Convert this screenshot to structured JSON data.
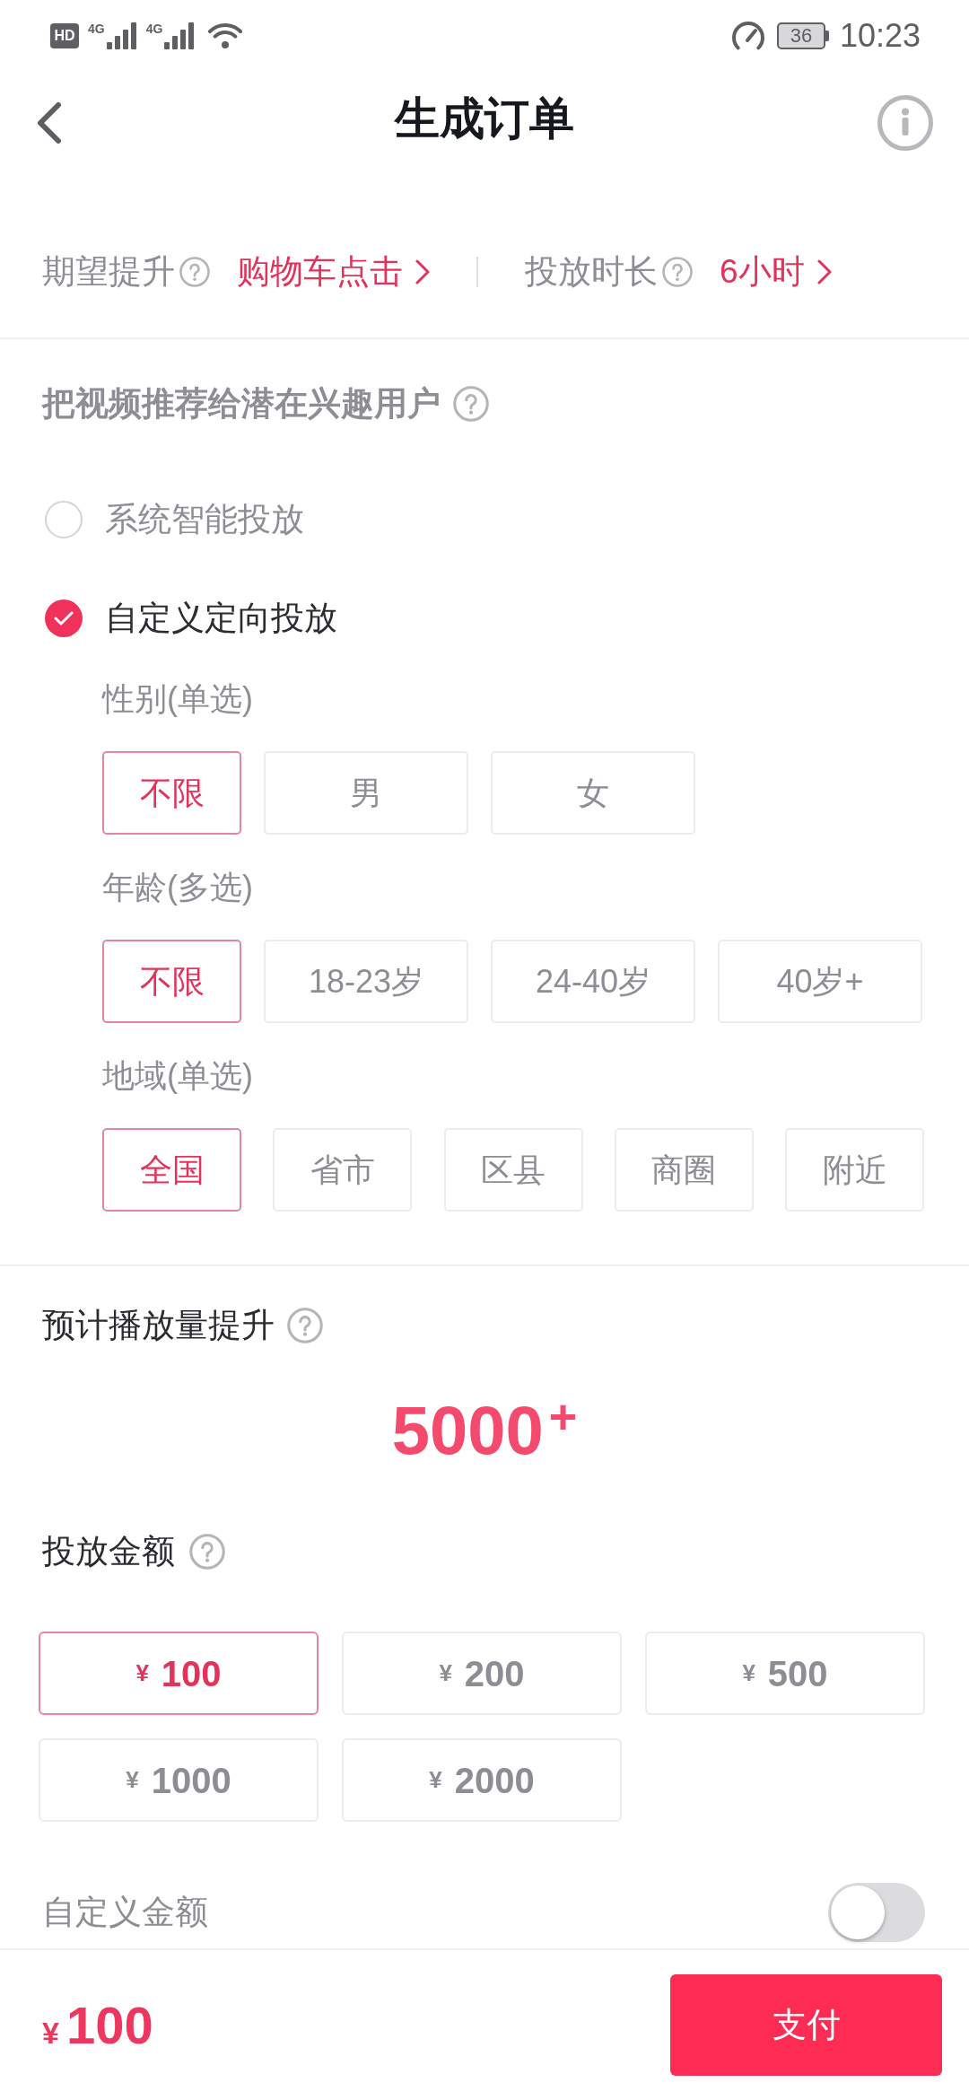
{
  "status_bar": {
    "hd": "HD",
    "networks": [
      {
        "label": "4G"
      },
      {
        "label": "4G"
      }
    ],
    "battery": "36",
    "time": "10:23"
  },
  "header": {
    "title": "生成订单"
  },
  "summary": [
    {
      "label": "期望提升",
      "value": "购物车点击"
    },
    {
      "label": "投放时长",
      "value": "6小时"
    }
  ],
  "targeting": {
    "title": "把视频推荐给潜在兴趣用户",
    "options": [
      {
        "label": "系统智能投放",
        "selected": false
      },
      {
        "label": "自定义定向投放",
        "selected": true
      }
    ],
    "groups": [
      {
        "label": "性别(单选)",
        "chips": [
          {
            "label": "不限",
            "selected": true
          },
          {
            "label": "男",
            "selected": false
          },
          {
            "label": "女",
            "selected": false
          }
        ]
      },
      {
        "label": "年龄(多选)",
        "chips": [
          {
            "label": "不限",
            "selected": true
          },
          {
            "label": "18-23岁",
            "selected": false
          },
          {
            "label": "24-40岁",
            "selected": false
          },
          {
            "label": "40岁+",
            "selected": false
          }
        ]
      },
      {
        "label": "地域(单选)",
        "chips": [
          {
            "label": "全国",
            "selected": true
          },
          {
            "label": "省市",
            "selected": false
          },
          {
            "label": "区县",
            "selected": false
          },
          {
            "label": "商圈",
            "selected": false
          },
          {
            "label": "附近",
            "selected": false
          }
        ]
      }
    ]
  },
  "estimate": {
    "label": "预计播放量提升",
    "value": "5000",
    "suffix": "+"
  },
  "budget": {
    "label": "投放金额",
    "amounts": [
      {
        "currency": "¥",
        "value": "100",
        "selected": true
      },
      {
        "currency": "¥",
        "value": "200",
        "selected": false
      },
      {
        "currency": "¥",
        "value": "500",
        "selected": false
      },
      {
        "currency": "¥",
        "value": "1000",
        "selected": false
      },
      {
        "currency": "¥",
        "value": "2000",
        "selected": false
      }
    ],
    "custom": {
      "label": "自定义金额",
      "on": false
    }
  },
  "footer": {
    "currency": "¥",
    "total": "100",
    "button": "支付"
  }
}
